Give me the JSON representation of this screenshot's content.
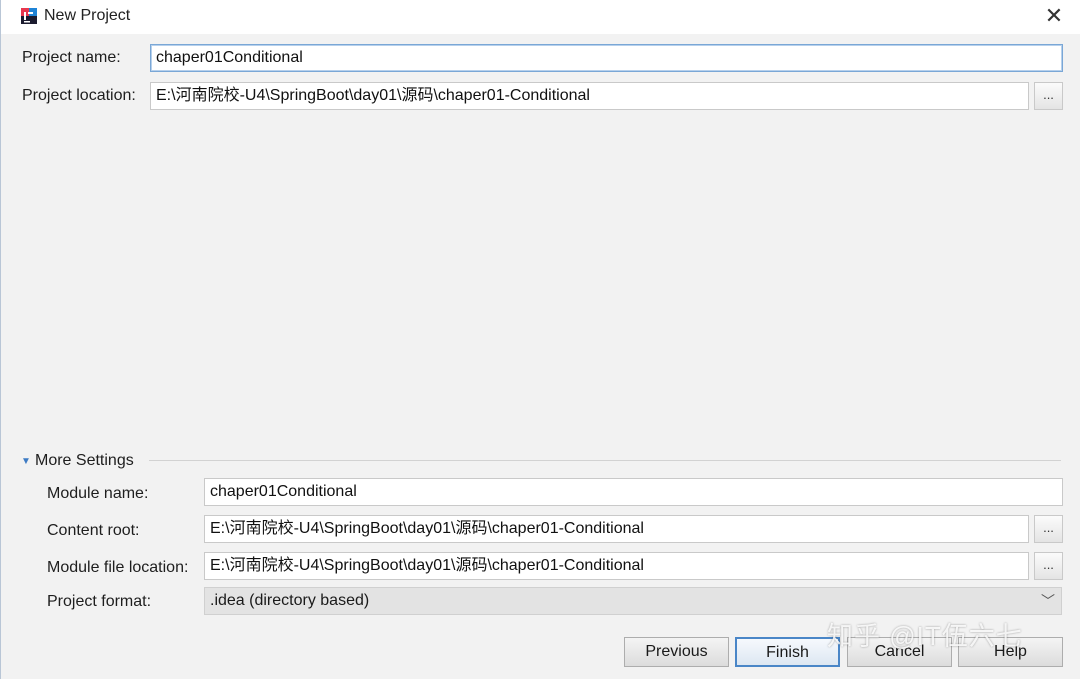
{
  "window": {
    "title": "New Project",
    "app_icon": "intellij-idea-icon",
    "close_glyph": "✕"
  },
  "project": {
    "name_label": "Project name:",
    "name_value": "chaper01Conditional",
    "location_label": "Project location:",
    "location_value": "E:\\河南院校-U4\\SpringBoot\\day01\\源码\\chaper01-Conditional",
    "browse_label": "..."
  },
  "more_settings": {
    "header": "More Settings",
    "expanded_icon": "triangle-down-icon",
    "module_name_label": "Module name:",
    "module_name_value": "chaper01Conditional",
    "content_root_label": "Content root:",
    "content_root_value": "E:\\河南院校-U4\\SpringBoot\\day01\\源码\\chaper01-Conditional",
    "module_file_label": "Module file location:",
    "module_file_value": "E:\\河南院校-U4\\SpringBoot\\day01\\源码\\chaper01-Conditional",
    "format_label": "Project format:",
    "format_value": ".idea (directory based)",
    "browse_label": "..."
  },
  "buttons": {
    "previous": "Previous",
    "finish": "Finish",
    "cancel": "Cancel",
    "help": "Help"
  },
  "watermark": "知乎 @IT伍六七",
  "colors": {
    "focus_border": "#7aa7d6",
    "default_button_border": "#4a86c7",
    "section_triangle": "#3d7bc4"
  }
}
